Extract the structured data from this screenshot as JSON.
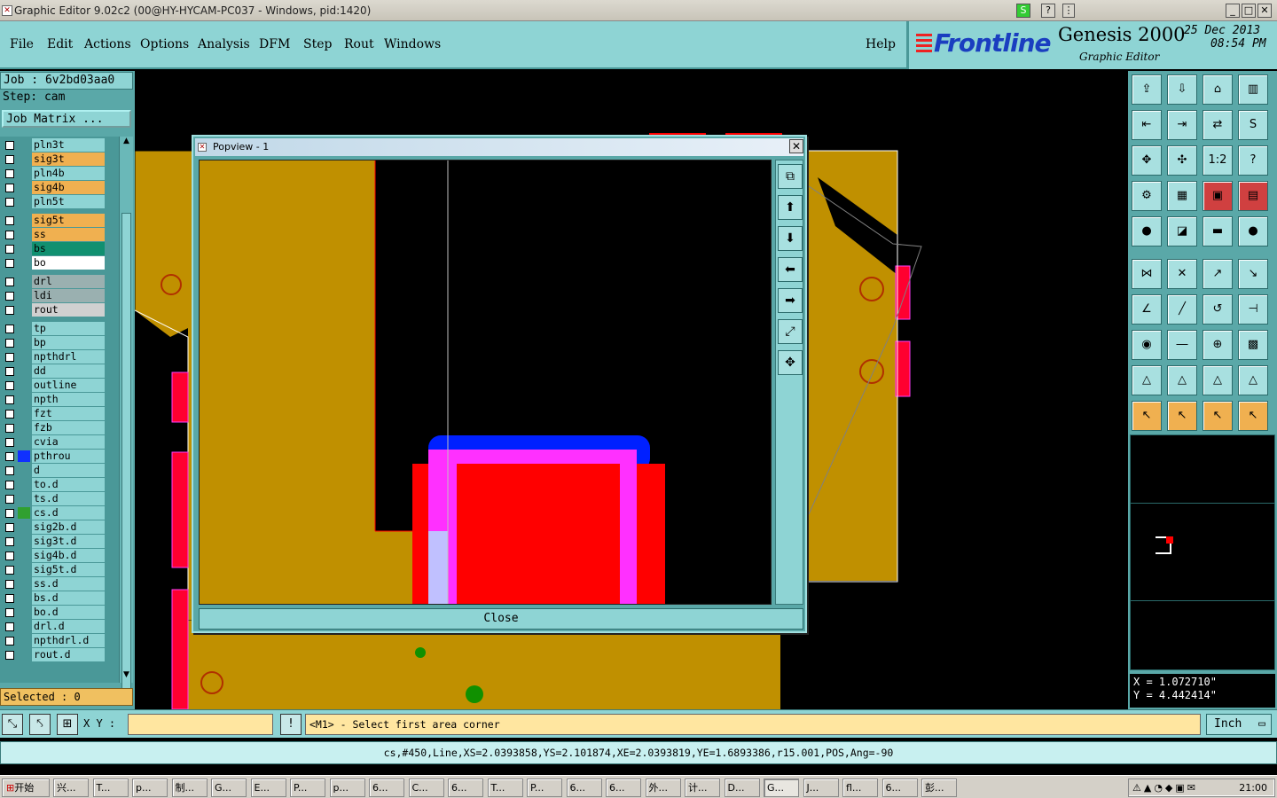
{
  "window": {
    "title": "Graphic Editor 9.02c2 (00@HY-HYCAM-PC037 - Windows, pid:1420)"
  },
  "menu": {
    "items": [
      "File",
      "Edit",
      "Actions",
      "Options",
      "Analysis",
      "DFM",
      "Step",
      "Rout",
      "Windows"
    ],
    "help": "Help"
  },
  "brand": {
    "logo": "Frontline",
    "product": "Genesis 2000",
    "subtitle": "Graphic Editor",
    "date": "25 Dec 2013",
    "time": "08:54 PM"
  },
  "job": {
    "job_label": "Job : 6v2bd03aa0",
    "step_label": "Step: cam",
    "matrix_button": "Job Matrix ..."
  },
  "layers": [
    {
      "name": "pln3t",
      "color": "#8ed4d4"
    },
    {
      "name": "sig3t",
      "color": "#f0b050"
    },
    {
      "name": "pln4b",
      "color": "#8ed4d4"
    },
    {
      "name": "sig4b",
      "color": "#f0b050"
    },
    {
      "name": "pln5t",
      "color": "#8ed4d4"
    },
    {
      "name": "sig5t",
      "color": "#f0b050"
    },
    {
      "name": "ss",
      "color": "#f0b050"
    },
    {
      "name": "bs",
      "color": "#109070"
    },
    {
      "name": "bo",
      "color": "#ffffff"
    },
    {
      "name": "drl",
      "color": "#9ab0b0"
    },
    {
      "name": "ldi",
      "color": "#9ab0b0"
    },
    {
      "name": "rout",
      "color": "#d0d0d0"
    },
    {
      "name": "tp",
      "color": "#8ed4d4"
    },
    {
      "name": "bp",
      "color": "#8ed4d4"
    },
    {
      "name": "npthdrl",
      "color": "#8ed4d4"
    },
    {
      "name": "dd",
      "color": "#8ed4d4"
    },
    {
      "name": "outline",
      "color": "#8ed4d4"
    },
    {
      "name": "npth",
      "color": "#8ed4d4"
    },
    {
      "name": "fzt",
      "color": "#8ed4d4"
    },
    {
      "name": "fzb",
      "color": "#8ed4d4"
    },
    {
      "name": "cvia",
      "color": "#8ed4d4"
    },
    {
      "name": "pthrou",
      "color": "#8ed4d4"
    },
    {
      "name": "d",
      "color": "#8ed4d4"
    },
    {
      "name": "to.d",
      "color": "#8ed4d4"
    },
    {
      "name": "ts.d",
      "color": "#8ed4d4"
    },
    {
      "name": "cs.d",
      "color": "#8ed4d4"
    },
    {
      "name": "sig2b.d",
      "color": "#8ed4d4"
    },
    {
      "name": "sig3t.d",
      "color": "#8ed4d4"
    },
    {
      "name": "sig4b.d",
      "color": "#8ed4d4"
    },
    {
      "name": "sig5t.d",
      "color": "#8ed4d4"
    },
    {
      "name": "ss.d",
      "color": "#8ed4d4"
    },
    {
      "name": "bs.d",
      "color": "#8ed4d4"
    },
    {
      "name": "bo.d",
      "color": "#8ed4d4"
    },
    {
      "name": "drl.d",
      "color": "#8ed4d4"
    },
    {
      "name": "npthdrl.d",
      "color": "#8ed4d4"
    },
    {
      "name": "rout.d",
      "color": "#8ed4d4"
    }
  ],
  "selected": "Selected : 0",
  "popview": {
    "title": "Popview - 1",
    "close_label": "Close"
  },
  "coords": {
    "x": "X = 1.072710\"",
    "y": "Y = 4.442414\""
  },
  "bottom": {
    "xy_label": "X Y :",
    "xy_value": "",
    "prompt": "<M1> - Select first area corner",
    "unit": "Inch"
  },
  "status": "cs,#450,Line,XS=2.0393858,YS=2.101874,XE=2.0393819,YE=1.6893386,r15.001,POS,Ang=-90",
  "taskbar": {
    "start": "开始",
    "tasks": [
      "兴...",
      "T...",
      "p...",
      "制...",
      "G...",
      "E...",
      "P...",
      "p...",
      "6...",
      "C...",
      "6...",
      "T...",
      "P...",
      "6...",
      "6...",
      "外...",
      "计...",
      "D...",
      "G...",
      "J...",
      "fl...",
      "6...",
      "彭..."
    ],
    "clock": "21:00"
  },
  "colors": {
    "panel": "#8ed4d4",
    "copper": "#c09000",
    "pad": "#ff0000"
  }
}
